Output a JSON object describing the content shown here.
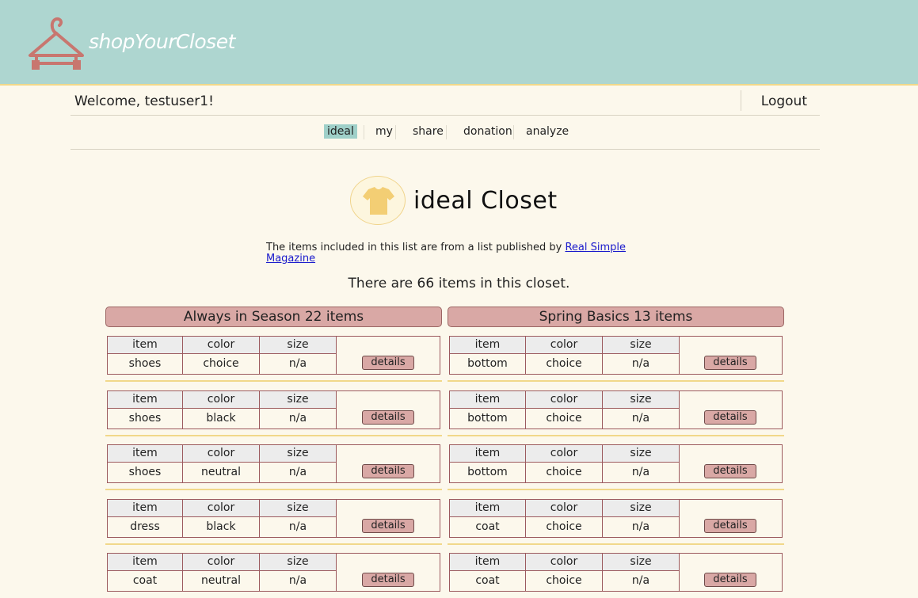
{
  "brand": {
    "name": "shopYourCloset"
  },
  "user": {
    "welcome": "Welcome, testuser1!",
    "logout_label": "Logout"
  },
  "nav": {
    "items": [
      {
        "label": "ideal",
        "active": true
      },
      {
        "label": "my",
        "active": false
      },
      {
        "label": "share",
        "active": false
      },
      {
        "label": "donation",
        "active": false
      },
      {
        "label": "analyze",
        "active": false
      }
    ]
  },
  "page": {
    "title": "ideal Closet",
    "intro_text": "The items included in this list are from a list published by ",
    "intro_link": "Real Simple Magazine",
    "count_text": "There are 66 items in this closet."
  },
  "colors": {
    "header_bg": "#aed6d0",
    "accent": "#f1d88a",
    "rose": "#d9a8a5",
    "active_nav": "#9fd0c9",
    "page_bg": "#fcf8ec"
  },
  "table_headers": {
    "item": "item",
    "color": "color",
    "size": "size",
    "details": "details"
  },
  "columns": [
    {
      "title": "Always in Season 22 items",
      "items": [
        {
          "item": "shoes",
          "color": "choice",
          "size": "n/a"
        },
        {
          "item": "shoes",
          "color": "black",
          "size": "n/a"
        },
        {
          "item": "shoes",
          "color": "neutral",
          "size": "n/a"
        },
        {
          "item": "dress",
          "color": "black",
          "size": "n/a"
        },
        {
          "item": "coat",
          "color": "neutral",
          "size": "n/a"
        }
      ]
    },
    {
      "title": "Spring Basics 13 items",
      "items": [
        {
          "item": "bottom",
          "color": "choice",
          "size": "n/a"
        },
        {
          "item": "bottom",
          "color": "choice",
          "size": "n/a"
        },
        {
          "item": "bottom",
          "color": "choice",
          "size": "n/a"
        },
        {
          "item": "coat",
          "color": "choice",
          "size": "n/a"
        },
        {
          "item": "coat",
          "color": "choice",
          "size": "n/a"
        }
      ]
    }
  ],
  "icons": {
    "logo": "hanger-icon",
    "title": "tshirt-icon"
  }
}
